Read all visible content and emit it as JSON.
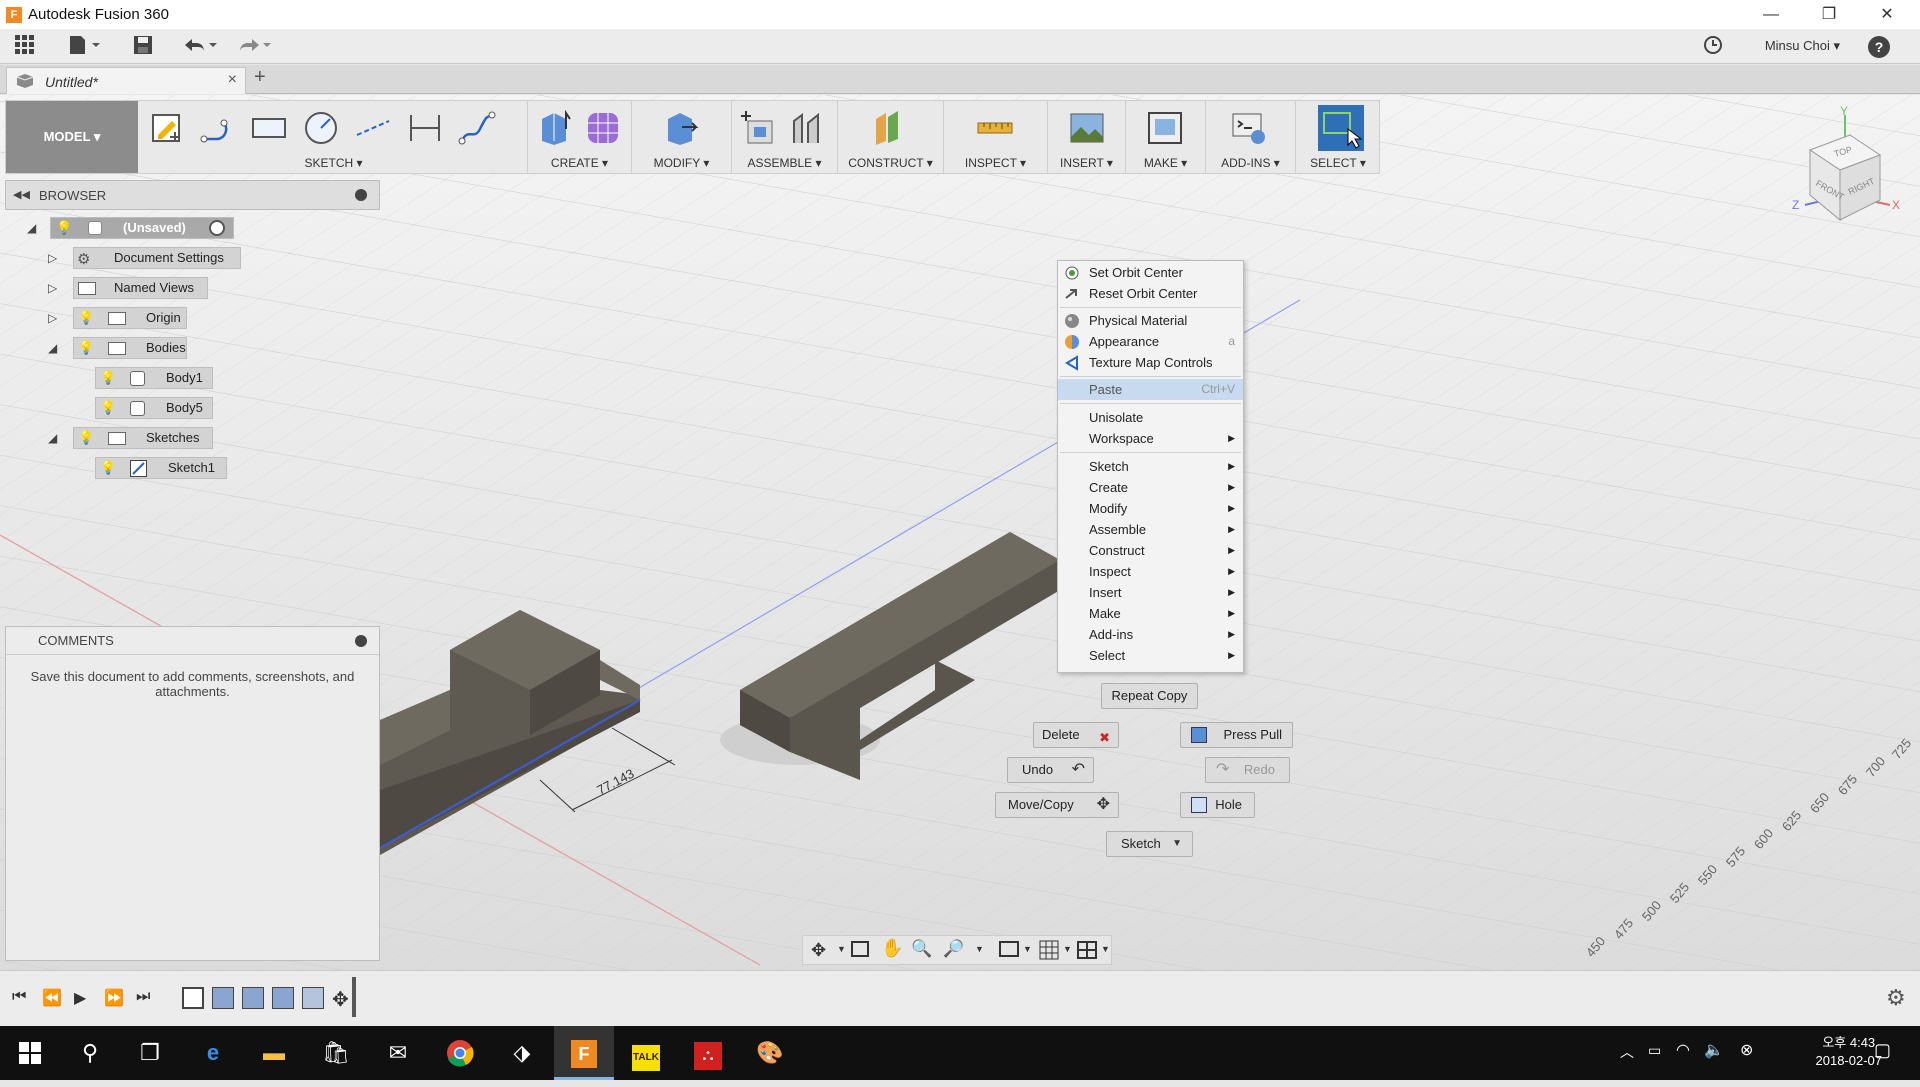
{
  "window": {
    "title": "Autodesk Fusion 360",
    "logo": "F",
    "minimize": "—",
    "restore": "❐",
    "close": "✕"
  },
  "qat": {
    "user": "Minsu Choi ▾",
    "help": "?"
  },
  "tab": {
    "name": "Untitled*",
    "close": "×",
    "new": "+"
  },
  "toolbar": {
    "model": "MODEL ▾",
    "groups": [
      "SKETCH ▾",
      "CREATE ▾",
      "MODIFY ▾",
      "ASSEMBLE ▾",
      "CONSTRUCT ▾",
      "INSPECT ▾",
      "INSERT ▾",
      "MAKE ▾",
      "ADD-INS ▾",
      "SELECT ▾"
    ]
  },
  "viewcube": {
    "top": "TOP",
    "front": "FRONT",
    "right": "RIGHT",
    "x": "X",
    "y": "Y",
    "z": "Z"
  },
  "browser": {
    "title": "BROWSER",
    "root": "(Unsaved)",
    "items": [
      {
        "label": "Document Settings"
      },
      {
        "label": "Named Views"
      },
      {
        "label": "Origin"
      },
      {
        "label": "Bodies"
      },
      {
        "label": "Body1"
      },
      {
        "label": "Body5"
      },
      {
        "label": "Sketches"
      },
      {
        "label": "Sketch1"
      }
    ]
  },
  "comments": {
    "title": "COMMENTS",
    "message": "Save this document to add comments, screenshots, and attachments."
  },
  "context_menu": {
    "items": [
      {
        "label": "Set Orbit Center"
      },
      {
        "label": "Reset Orbit Center"
      },
      {
        "label": "Physical Material"
      },
      {
        "label": "Appearance",
        "shortcut": "a"
      },
      {
        "label": "Texture Map Controls"
      },
      {
        "label": "Paste",
        "shortcut": "Ctrl+V"
      },
      {
        "label": "Unisolate"
      },
      {
        "label": "Workspace"
      },
      {
        "label": "Sketch"
      },
      {
        "label": "Create"
      },
      {
        "label": "Modify"
      },
      {
        "label": "Assemble"
      },
      {
        "label": "Construct"
      },
      {
        "label": "Inspect"
      },
      {
        "label": "Insert"
      },
      {
        "label": "Make"
      },
      {
        "label": "Add-ins"
      },
      {
        "label": "Select"
      }
    ]
  },
  "marking_menu": {
    "repeat": "Repeat Copy",
    "delete": "Delete",
    "press_pull": "Press Pull",
    "undo": "Undo",
    "redo": "Redo",
    "move_copy": "Move/Copy",
    "hole": "Hole",
    "sketch": "Sketch"
  },
  "dimension": "77.143",
  "ruler_ticks": [
    "450",
    "475",
    "500",
    "525",
    "550",
    "575",
    "600",
    "625",
    "650",
    "675",
    "700",
    "725"
  ],
  "taskbar": {
    "time": "오후 4:43",
    "date": "2018-02-07",
    "talk": "TALK"
  }
}
